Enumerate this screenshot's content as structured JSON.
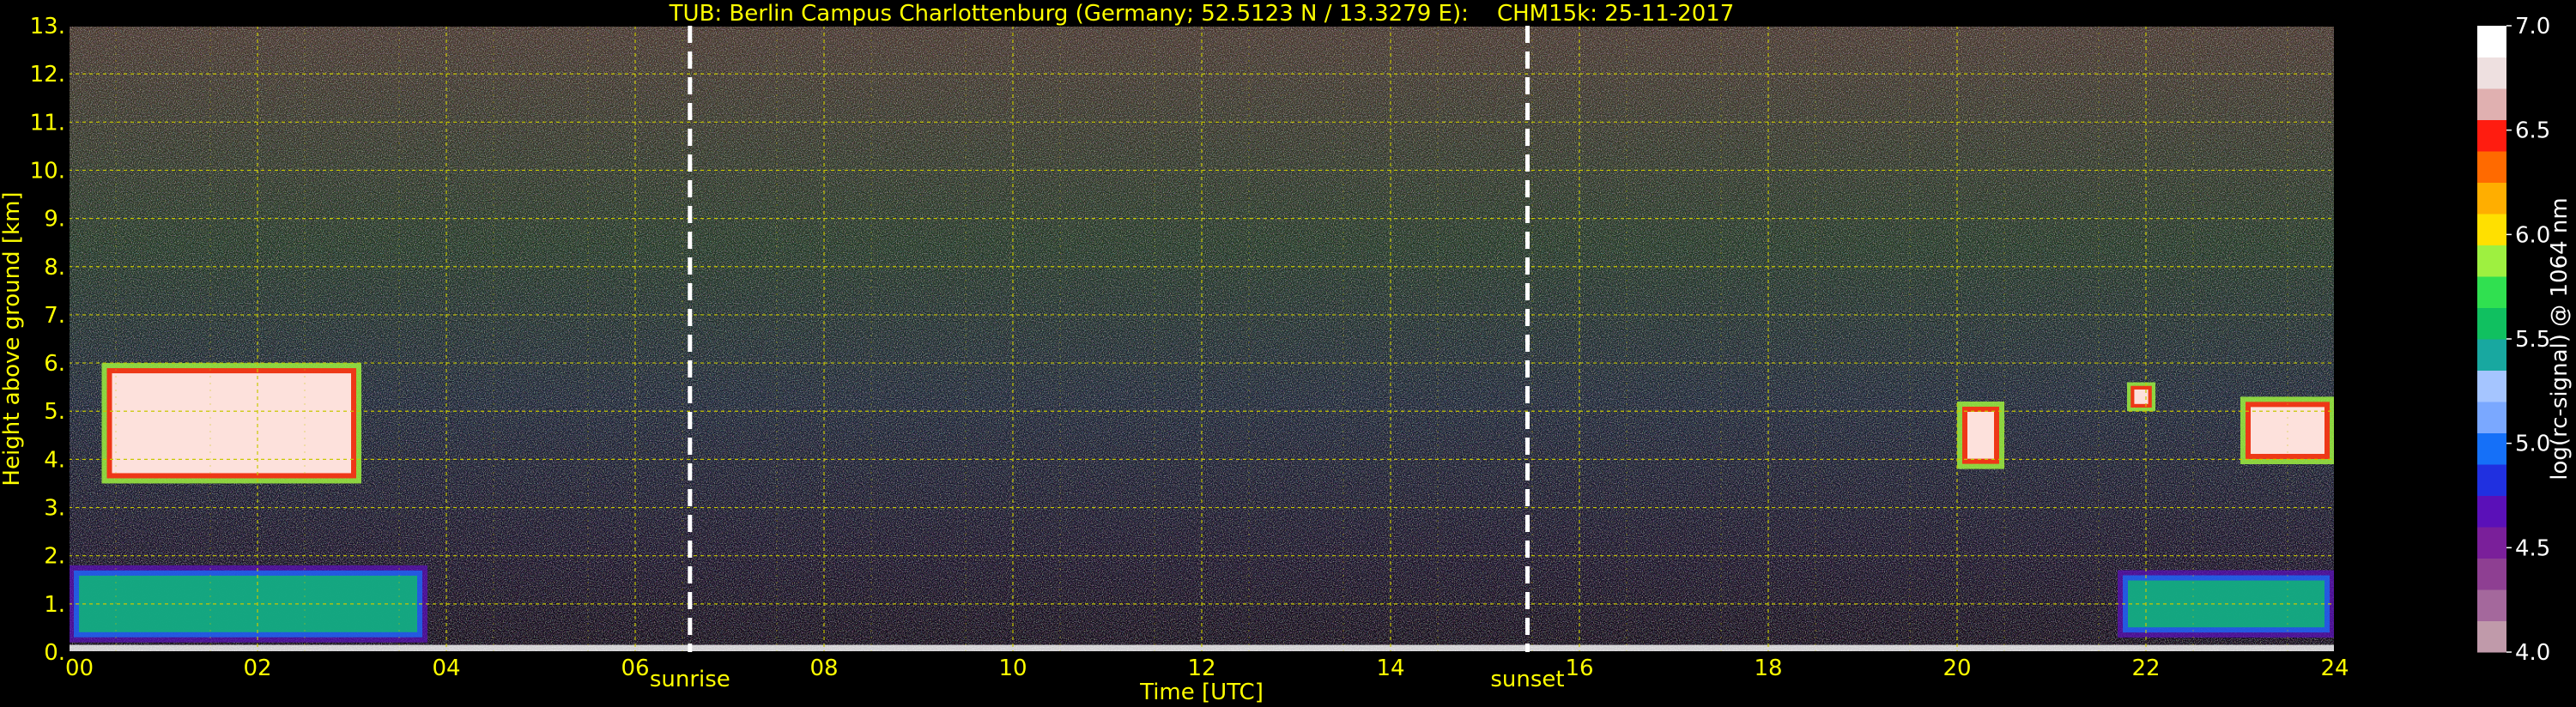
{
  "chart_data": {
    "type": "heatmap",
    "title": "TUB: Berlin Campus Charlottenburg (Germany; 52.5123 N / 13.3279 E):    CHM15k: 25-11-2017",
    "xlabel": "Time [UTC]",
    "ylabel": "Height above ground [km]",
    "xlim": [
      0,
      24
    ],
    "ylim": [
      0,
      13
    ],
    "x_ticks": [
      "00",
      "02",
      "04",
      "06",
      "08",
      "10",
      "12",
      "14",
      "16",
      "18",
      "20",
      "22",
      "24"
    ],
    "y_ticks": [
      "0.",
      "1.",
      "2.",
      "3.",
      "4.",
      "5.",
      "6.",
      "7.",
      "8.",
      "9.",
      "10.",
      "11.",
      "12.",
      "13."
    ],
    "grid": true,
    "annotations": [
      {
        "label": "sunrise",
        "x": 6.58
      },
      {
        "label": "sunset",
        "x": 15.45
      }
    ],
    "colorbar": {
      "label": "log(rc-signal) @ 1064 nm",
      "range": [
        4.0,
        7.0
      ],
      "ticks": [
        "4.0",
        "4.5",
        "5.0",
        "5.5",
        "6.0",
        "6.5",
        "7.0"
      ]
    },
    "features": [
      {
        "kind": "cloud layer",
        "x": [
          0.35,
          3.1
        ],
        "y": [
          3.5,
          6.0
        ]
      },
      {
        "kind": "boundary layer",
        "x": [
          0,
          3.8
        ],
        "y": [
          0.2,
          1.8
        ]
      },
      {
        "kind": "cloud layer",
        "x": [
          23.0,
          24
        ],
        "y": [
          3.9,
          5.3
        ]
      },
      {
        "kind": "cloud layer",
        "x": [
          20.0,
          20.5
        ],
        "y": [
          3.8,
          5.2
        ]
      },
      {
        "kind": "cloud layer",
        "x": [
          21.8,
          22.1
        ],
        "y": [
          5.0,
          5.6
        ]
      },
      {
        "kind": "boundary layer",
        "x": [
          21.7,
          24
        ],
        "y": [
          0.3,
          1.7
        ]
      }
    ]
  },
  "colors": {
    "text": "#ffff00",
    "grid": "#c8c800",
    "marker": "#ffffff",
    "colormap": [
      "#c09aaa",
      "#a4689c",
      "#8e3f92",
      "#7a1f9a",
      "#5a10b8",
      "#2030e0",
      "#1570f8",
      "#7aa8ff",
      "#a5c5ff",
      "#18a8a0",
      "#10c060",
      "#30e050",
      "#9ef040",
      "#ffe000",
      "#ffae00",
      "#ff6a00",
      "#ff1c10",
      "#e0b0b0",
      "#eee0e0",
      "#ffffff"
    ]
  }
}
